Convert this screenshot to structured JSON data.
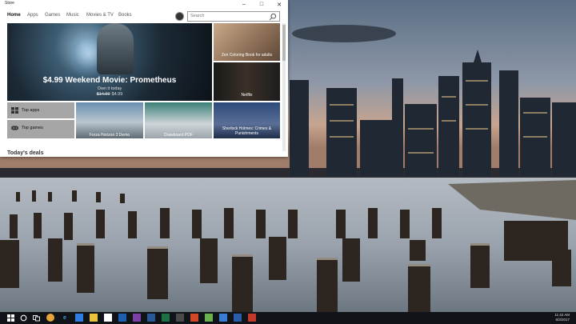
{
  "window": {
    "title": "Store"
  },
  "nav": {
    "items": [
      "Home",
      "Apps",
      "Games",
      "Music",
      "Movies & TV",
      "Books"
    ]
  },
  "search": {
    "placeholder": "Search"
  },
  "hero": {
    "title": "$4.99 Weekend Movie: Prometheus",
    "subtitle": "Own it today",
    "old_price": "$14.99",
    "new_price": "$4.99"
  },
  "tiles": {
    "zen": "Zen Coloring Book for adults",
    "netflix": "Netflix",
    "top_apps": "Top apps",
    "top_games": "Top games",
    "forza": "Forza Horizon 3 Demo",
    "pdf": "Drawboard PDF",
    "stranger": "Sherlock Holmes: Crimes & Punishments"
  },
  "section": {
    "title": "Today's deals"
  },
  "clock": {
    "time": "11:42 AM",
    "date": "6/3/2017"
  }
}
